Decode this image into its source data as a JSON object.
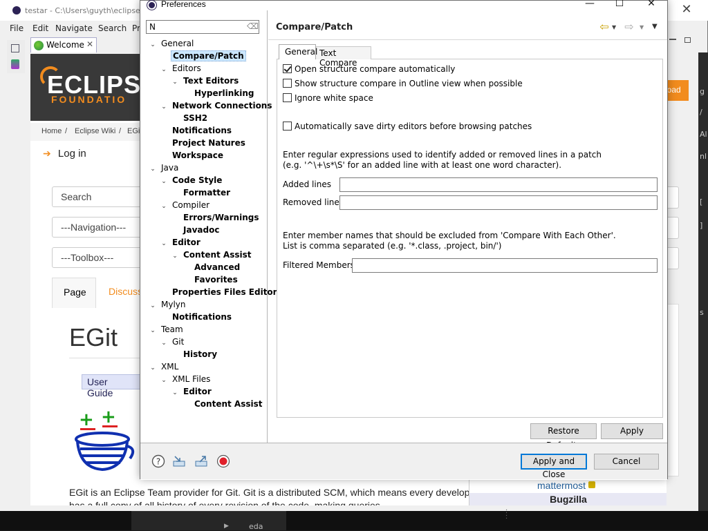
{
  "ide": {
    "title": "testar - C:\\Users\\guyth\\eclipse\\",
    "menu": [
      "File",
      "Edit",
      "Navigate",
      "Search",
      "Pr"
    ],
    "welcome_tab": "Welcome",
    "welcome_tab_close": "✕"
  },
  "web": {
    "banner_line1": "ECLIPSI",
    "banner_line2": "FOUNDATIO",
    "crumbs": [
      "Home",
      "/",
      "Eclipse Wiki",
      "/",
      "EGi"
    ],
    "login": "Log in",
    "search_placeholder": "Search",
    "navigation_select": "---Navigation---",
    "toolbox_select": "---Toolbox---",
    "tab_page": "Page",
    "tab_discuss": "Discuss",
    "title": "EGit",
    "user_guide": "User Guide",
    "description": "EGit is an Eclipse Team provider for Git. Git is a distributed SCM, which means every developer has a full copy of all history of every revision of the code, making queries",
    "download": "load",
    "mattermost": "mattermost",
    "bugzilla": "Bugzilla"
  },
  "taskbar": {
    "item": "eda"
  },
  "dialog": {
    "title": "Preferences",
    "filter_value": "N",
    "page_title": "Compare/Patch",
    "tree": [
      {
        "label": "General",
        "level": 0,
        "toggle": "open",
        "bold": false
      },
      {
        "label": "Compare/Patch",
        "level": 1,
        "toggle": "none",
        "bold": true,
        "selected": true
      },
      {
        "label": "Editors",
        "level": 1,
        "toggle": "open",
        "bold": false
      },
      {
        "label": "Text Editors",
        "level": 2,
        "toggle": "open",
        "bold": true
      },
      {
        "label": "Hyperlinking",
        "level": 3,
        "toggle": "none",
        "bold": true
      },
      {
        "label": "Network Connections",
        "level": 1,
        "toggle": "open",
        "bold": true
      },
      {
        "label": "SSH2",
        "level": 2,
        "toggle": "none",
        "bold": true
      },
      {
        "label": "Notifications",
        "level": 1,
        "toggle": "none",
        "bold": true
      },
      {
        "label": "Project Natures",
        "level": 1,
        "toggle": "none",
        "bold": true
      },
      {
        "label": "Workspace",
        "level": 1,
        "toggle": "none",
        "bold": true
      },
      {
        "label": "Java",
        "level": 0,
        "toggle": "open",
        "bold": false
      },
      {
        "label": "Code Style",
        "level": 1,
        "toggle": "open",
        "bold": true
      },
      {
        "label": "Formatter",
        "level": 2,
        "toggle": "none",
        "bold": true
      },
      {
        "label": "Compiler",
        "level": 1,
        "toggle": "open",
        "bold": false
      },
      {
        "label": "Errors/Warnings",
        "level": 2,
        "toggle": "none",
        "bold": true
      },
      {
        "label": "Javadoc",
        "level": 2,
        "toggle": "none",
        "bold": true
      },
      {
        "label": "Editor",
        "level": 1,
        "toggle": "open",
        "bold": true
      },
      {
        "label": "Content Assist",
        "level": 2,
        "toggle": "open",
        "bold": true
      },
      {
        "label": "Advanced",
        "level": 3,
        "toggle": "none",
        "bold": true
      },
      {
        "label": "Favorites",
        "level": 3,
        "toggle": "none",
        "bold": true
      },
      {
        "label": "Properties Files Editor",
        "level": 1,
        "toggle": "none",
        "bold": true
      },
      {
        "label": "Mylyn",
        "level": 0,
        "toggle": "open",
        "bold": false
      },
      {
        "label": "Notifications",
        "level": 1,
        "toggle": "none",
        "bold": true
      },
      {
        "label": "Team",
        "level": 0,
        "toggle": "open",
        "bold": false
      },
      {
        "label": "Git",
        "level": 1,
        "toggle": "open",
        "bold": false
      },
      {
        "label": "History",
        "level": 2,
        "toggle": "none",
        "bold": true
      },
      {
        "label": "XML",
        "level": 0,
        "toggle": "open",
        "bold": false
      },
      {
        "label": "XML Files",
        "level": 1,
        "toggle": "open",
        "bold": false
      },
      {
        "label": "Editor",
        "level": 2,
        "toggle": "open",
        "bold": true
      },
      {
        "label": "Content Assist",
        "level": 3,
        "toggle": "none",
        "bold": true
      }
    ],
    "tabs": {
      "general": "General",
      "text_compare": "Text Compare"
    },
    "options": {
      "open_structure": {
        "label": "Open structure compare automatically",
        "checked": true
      },
      "show_outline": {
        "label": "Show structure compare in Outline view when possible",
        "checked": false
      },
      "ignore_whitespace": {
        "label": "Ignore white space",
        "checked": false
      },
      "autosave": {
        "label": "Automatically save dirty editors before browsing patches",
        "checked": false
      }
    },
    "regex_help_line1": "Enter regular expressions used to identify added or removed lines in a patch",
    "regex_help_line2": "(e.g. '^\\+\\s*\\S' for an added line with at least one word character).",
    "added_lines_label": "Added lines",
    "added_lines_value": "",
    "removed_lines_label": "Removed lines",
    "removed_lines_value": "",
    "member_help_line1": "Enter member names that should be excluded from 'Compare With Each Other'.",
    "member_help_line2": "List is comma separated (e.g. '*.class, .project, bin/')",
    "filtered_members_label": "Filtered Members:",
    "filtered_members_value": "",
    "restore_defaults": "Restore Defaults",
    "apply": "Apply",
    "apply_and_close": "Apply and Close",
    "cancel": "Cancel",
    "footer_icons": [
      "help-icon",
      "import-icon",
      "export-icon",
      "record-icon"
    ]
  }
}
